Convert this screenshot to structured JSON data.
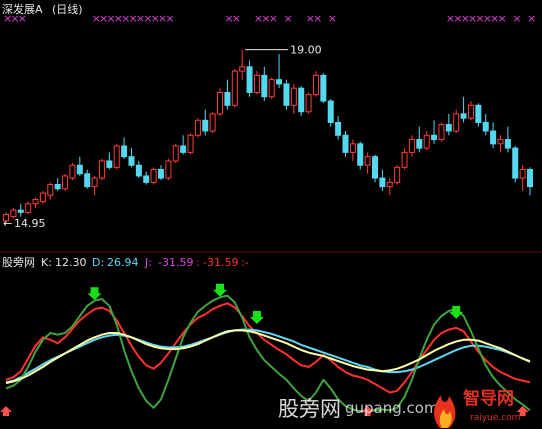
{
  "colors": {
    "background": "#000000",
    "up_candle": "#ff3a3a",
    "down_candle": "#54d8f0",
    "title_text": "#e8e8e8",
    "signal_x": "#e040e0",
    "k_line": "#ff3030",
    "d_line": "#5fd7f5",
    "j_line": "#3fa33f",
    "extra_line": "#ffffa8",
    "arrow": "#19e019",
    "divider": "#6a1010"
  },
  "header": {
    "title": "深发展A",
    "period": "(日线)"
  },
  "price_panel": {
    "high_label": "19.00",
    "low_label": "14.95",
    "ylim": [
      14.6,
      19.6
    ]
  },
  "indicator_header": {
    "name": "股旁网",
    "k_label": "K:",
    "k_value": "12.30",
    "d_label": "D:",
    "d_value": "26.94",
    "j_label": "J:",
    "j_value": "-31.59",
    "extra_label": ":",
    "extra_value": "-31.59",
    "tail": ":-"
  },
  "watermark": {
    "site_cn": "股旁网",
    "site_url": "gupang.com",
    "brand_cn": "智导网",
    "brand_url": "raiyue.com"
  },
  "chart_data": [
    {
      "type": "candlestick",
      "title": "深发展A (日线)",
      "annotations": [
        {
          "text": "19.00",
          "value": 19.0,
          "kind": "high"
        },
        {
          "text": "14.95",
          "value": 14.95,
          "kind": "low"
        }
      ],
      "ylim": [
        14.6,
        19.6
      ],
      "grid": false,
      "candles": [
        [
          15.0,
          15.2,
          14.95,
          15.15
        ],
        [
          15.1,
          15.3,
          15.05,
          15.25
        ],
        [
          15.25,
          15.4,
          15.1,
          15.2
        ],
        [
          15.2,
          15.45,
          15.15,
          15.4
        ],
        [
          15.4,
          15.55,
          15.3,
          15.5
        ],
        [
          15.45,
          15.7,
          15.4,
          15.65
        ],
        [
          15.6,
          15.9,
          15.5,
          15.85
        ],
        [
          15.85,
          16.0,
          15.7,
          15.75
        ],
        [
          15.75,
          16.1,
          15.7,
          16.05
        ],
        [
          16.0,
          16.35,
          15.95,
          16.3
        ],
        [
          16.3,
          16.5,
          16.05,
          16.1
        ],
        [
          16.1,
          16.2,
          15.75,
          15.8
        ],
        [
          15.8,
          16.05,
          15.6,
          16.0
        ],
        [
          16.0,
          16.45,
          15.95,
          16.4
        ],
        [
          16.4,
          16.6,
          16.2,
          16.25
        ],
        [
          16.25,
          16.8,
          16.2,
          16.75
        ],
        [
          16.75,
          16.95,
          16.45,
          16.5
        ],
        [
          16.5,
          16.7,
          16.25,
          16.3
        ],
        [
          16.3,
          16.4,
          16.0,
          16.05
        ],
        [
          16.05,
          16.15,
          15.85,
          15.9
        ],
        [
          15.9,
          16.25,
          15.85,
          16.2
        ],
        [
          16.2,
          16.3,
          15.95,
          16.0
        ],
        [
          16.0,
          16.45,
          15.95,
          16.4
        ],
        [
          16.4,
          16.8,
          16.35,
          16.75
        ],
        [
          16.75,
          17.0,
          16.55,
          16.6
        ],
        [
          16.6,
          17.05,
          16.55,
          17.0
        ],
        [
          17.0,
          17.4,
          16.95,
          17.35
        ],
        [
          17.35,
          17.6,
          17.0,
          17.1
        ],
        [
          17.1,
          17.55,
          17.05,
          17.5
        ],
        [
          17.5,
          18.1,
          17.45,
          18.0
        ],
        [
          18.0,
          18.3,
          17.6,
          17.7
        ],
        [
          17.7,
          18.55,
          17.65,
          18.5
        ],
        [
          18.5,
          19.0,
          18.3,
          18.6
        ],
        [
          18.6,
          18.75,
          17.9,
          18.0
        ],
        [
          18.0,
          18.5,
          17.95,
          18.4
        ],
        [
          18.4,
          18.6,
          17.8,
          17.9
        ],
        [
          17.9,
          18.35,
          17.85,
          18.3
        ],
        [
          18.3,
          18.9,
          18.1,
          18.2
        ],
        [
          18.2,
          18.3,
          17.6,
          17.7
        ],
        [
          17.7,
          18.2,
          17.5,
          18.1
        ],
        [
          18.1,
          18.15,
          17.45,
          17.55
        ],
        [
          17.55,
          18.0,
          17.5,
          17.95
        ],
        [
          17.95,
          18.5,
          17.9,
          18.4
        ],
        [
          18.4,
          18.45,
          17.75,
          17.8
        ],
        [
          17.8,
          17.85,
          17.2,
          17.3
        ],
        [
          17.3,
          17.45,
          16.9,
          17.0
        ],
        [
          17.0,
          17.1,
          16.5,
          16.6
        ],
        [
          16.6,
          16.9,
          16.4,
          16.8
        ],
        [
          16.8,
          16.85,
          16.2,
          16.3
        ],
        [
          16.3,
          16.6,
          16.1,
          16.5
        ],
        [
          16.5,
          16.55,
          15.9,
          16.0
        ],
        [
          16.0,
          16.2,
          15.7,
          15.8
        ],
        [
          15.8,
          16.0,
          15.6,
          15.9
        ],
        [
          15.9,
          16.3,
          15.85,
          16.25
        ],
        [
          16.25,
          16.7,
          16.2,
          16.6
        ],
        [
          16.6,
          17.0,
          16.5,
          16.9
        ],
        [
          16.9,
          17.2,
          16.6,
          16.7
        ],
        [
          16.7,
          17.1,
          16.65,
          17.0
        ],
        [
          17.0,
          17.35,
          16.8,
          16.9
        ],
        [
          16.9,
          17.3,
          16.85,
          17.25
        ],
        [
          17.25,
          17.5,
          17.0,
          17.1
        ],
        [
          17.1,
          17.6,
          17.05,
          17.5
        ],
        [
          17.5,
          17.9,
          17.3,
          17.4
        ],
        [
          17.4,
          17.8,
          17.35,
          17.7
        ],
        [
          17.7,
          17.75,
          17.2,
          17.3
        ],
        [
          17.3,
          17.5,
          17.0,
          17.1
        ],
        [
          17.1,
          17.3,
          16.7,
          16.8
        ],
        [
          16.8,
          17.0,
          16.6,
          16.9
        ],
        [
          16.9,
          17.2,
          16.6,
          16.7
        ],
        [
          16.7,
          16.75,
          15.9,
          16.0
        ],
        [
          16.0,
          16.3,
          15.7,
          16.2
        ],
        [
          16.2,
          16.25,
          15.6,
          15.8
        ]
      ]
    },
    {
      "type": "line",
      "title": "股旁网",
      "grid": false,
      "ylim": [
        -40,
        120
      ],
      "series": [
        {
          "name": "K",
          "values": [
            5,
            8,
            15,
            30,
            45,
            55,
            52,
            48,
            55,
            65,
            75,
            82,
            88,
            90,
            86,
            75,
            60,
            45,
            32,
            22,
            18,
            25,
            36,
            48,
            60,
            70,
            78,
            82,
            88,
            92,
            95,
            90,
            80,
            68,
            60,
            52,
            46,
            40,
            35,
            28,
            22,
            20,
            26,
            34,
            28,
            20,
            14,
            10,
            8,
            5,
            0,
            -5,
            -10,
            -8,
            2,
            14,
            28,
            40,
            52,
            60,
            64,
            66,
            62,
            50,
            38,
            28,
            20,
            14,
            10,
            6,
            4,
            2
          ]
        },
        {
          "name": "D",
          "values": [
            2,
            4,
            8,
            13,
            18,
            23,
            28,
            32,
            36,
            40,
            44,
            48,
            52,
            55,
            57,
            58,
            57,
            55,
            52,
            49,
            46,
            44,
            43,
            43,
            44,
            46,
            49,
            52,
            55,
            58,
            61,
            63,
            64,
            64,
            63,
            61,
            59,
            56,
            53,
            50,
            46,
            43,
            40,
            37,
            34,
            31,
            28,
            25,
            22,
            20,
            17,
            15,
            14,
            14,
            15,
            17,
            20,
            24,
            28,
            32,
            36,
            40,
            43,
            45,
            45,
            44,
            42,
            40,
            37,
            34,
            30,
            27
          ]
        },
        {
          "name": "J",
          "values": [
            -5,
            -2,
            5,
            20,
            38,
            52,
            60,
            58,
            60,
            68,
            80,
            92,
            98,
            100,
            92,
            70,
            40,
            15,
            -5,
            -20,
            -28,
            -18,
            5,
            30,
            55,
            72,
            85,
            92,
            98,
            102,
            104,
            96,
            78,
            55,
            40,
            28,
            20,
            12,
            5,
            -5,
            -14,
            -20,
            -10,
            5,
            -5,
            -18,
            -26,
            -30,
            -32,
            -31,
            -31,
            -30,
            -31,
            -28,
            -15,
            5,
            30,
            52,
            70,
            80,
            86,
            88,
            80,
            62,
            42,
            22,
            8,
            -2,
            -10,
            -18,
            -24,
            -31
          ]
        },
        {
          "name": "",
          "values": [
            1,
            3,
            6,
            10,
            15,
            20,
            26,
            31,
            36,
            41,
            46,
            51,
            55,
            58,
            60,
            60,
            58,
            55,
            51,
            47,
            44,
            42,
            41,
            41,
            42,
            44,
            47,
            51,
            55,
            59,
            62,
            63,
            63,
            62,
            60,
            57,
            54,
            51,
            48,
            44,
            40,
            37,
            35,
            33,
            30,
            27,
            24,
            21,
            19,
            17,
            16,
            15,
            16,
            18,
            21,
            25,
            29,
            34,
            39,
            43,
            47,
            50,
            52,
            52,
            51,
            48,
            45,
            42,
            38,
            34,
            30,
            26
          ]
        }
      ],
      "markers": {
        "arrow_down_at": [
          12,
          29,
          34,
          61
        ],
        "arrow_up_at": [
          0,
          49,
          70
        ]
      }
    }
  ]
}
